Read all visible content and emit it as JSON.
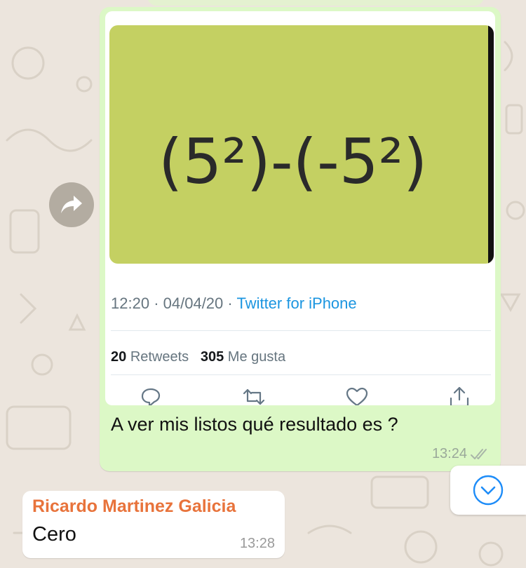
{
  "tweet": {
    "image_expression": "(5²)-(-5²)",
    "time": "12:20",
    "date": "04/04/20",
    "separator": "·",
    "source": "Twitter for iPhone",
    "retweets_count": "20",
    "retweets_label": "Retweets",
    "likes_count": "305",
    "likes_label": "Me gusta",
    "icons": [
      "reply-icon",
      "retweet-icon",
      "like-icon",
      "share-icon"
    ]
  },
  "outgoing_message": {
    "text": "A ver mis listos qué resultado es ?",
    "time": "13:24",
    "status_icon": "double-check-icon"
  },
  "incoming_message": {
    "sender": "Ricardo Martinez Galicia",
    "text": "Cero",
    "time": "13:28"
  },
  "controls": {
    "forward_icon": "forward-icon",
    "scroll_icon": "chevron-down-icon"
  },
  "colors": {
    "chat_background": "#ece5dd",
    "outgoing_bubble": "#dcf8c6",
    "incoming_bubble": "#ffffff",
    "sender_name": "#e8733b",
    "twitter_link": "#1b95e0",
    "accent_blue": "#1d8cf8"
  }
}
